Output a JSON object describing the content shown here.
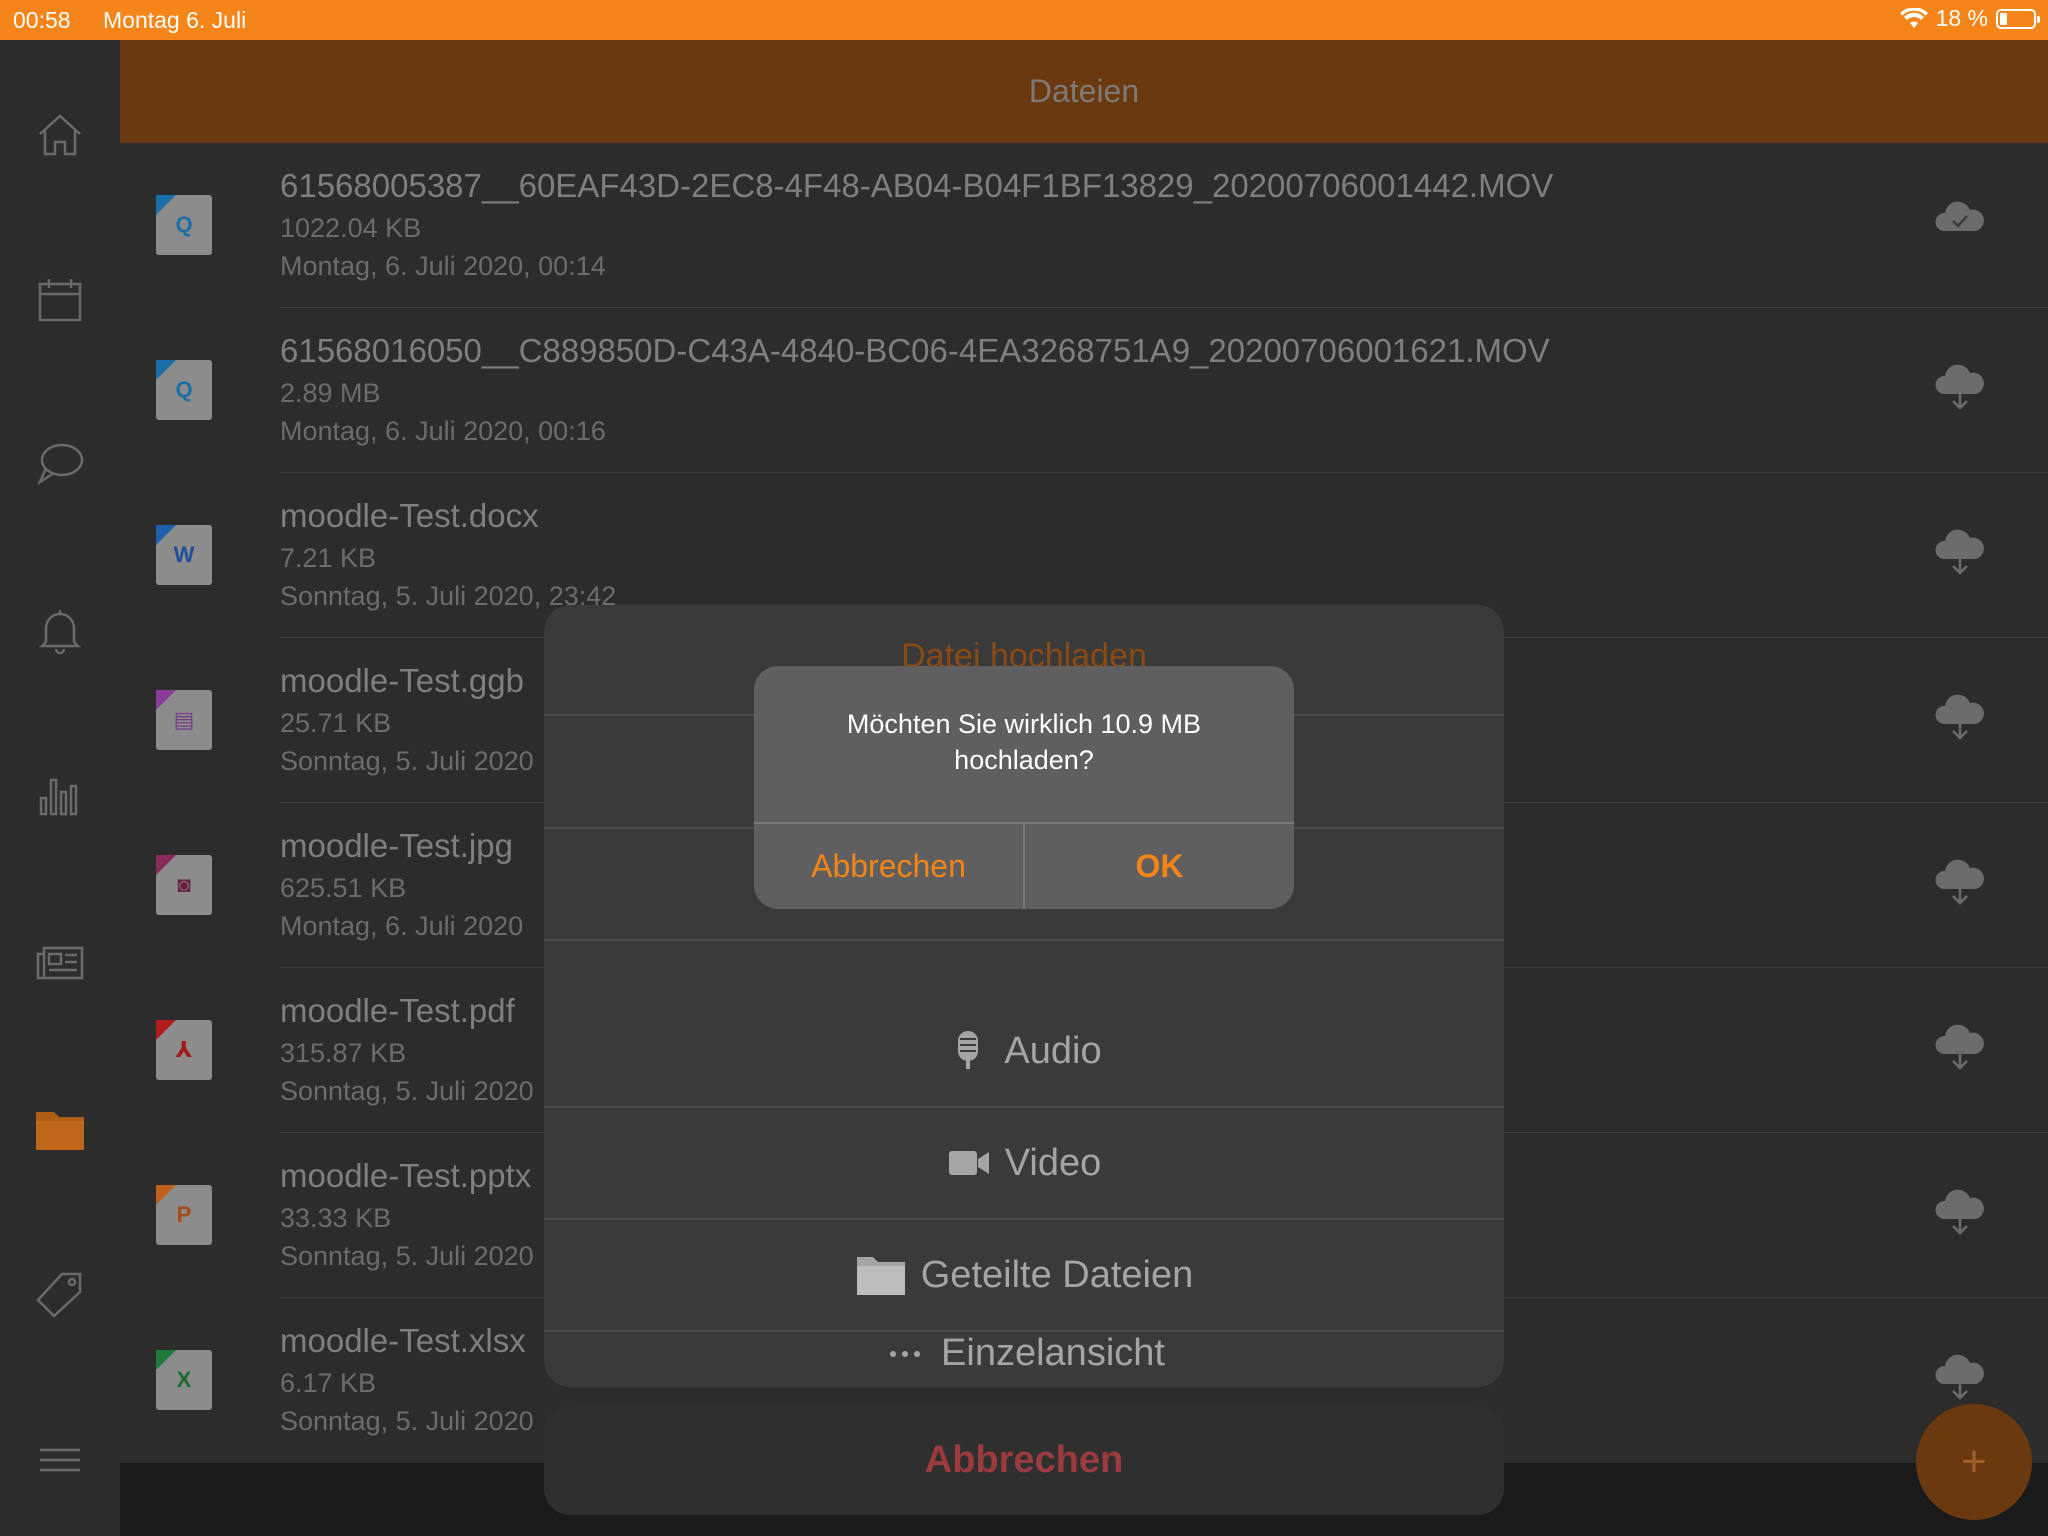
{
  "status_bar": {
    "time": "00:58",
    "date": "Montag 6. Juli",
    "battery": "18 %",
    "battery_level": 0.18
  },
  "sidebar": {
    "items": [
      {
        "icon": "home-icon"
      },
      {
        "icon": "calendar-icon"
      },
      {
        "icon": "chat-icon"
      },
      {
        "icon": "bell-icon"
      },
      {
        "icon": "bar-chart-icon"
      },
      {
        "icon": "news-icon"
      },
      {
        "icon": "folder-icon",
        "active": true
      },
      {
        "icon": "tag-icon"
      },
      {
        "icon": "menu-icon"
      }
    ]
  },
  "header": {
    "title": "Dateien"
  },
  "files": [
    {
      "name": "61568005387__60EAF43D-2EC8-4F48-AB04-B04F1BF13829_20200706001442.MOV",
      "size": "1022.04 KB",
      "date": "Montag, 6. Juli 2020, 00:14",
      "type": "mov",
      "status": "cloud-check-icon"
    },
    {
      "name": "61568016050__C889850D-C43A-4840-BC06-4EA3268751A9_20200706001621.MOV",
      "size": "2.89 MB",
      "date": "Montag, 6. Juli 2020, 00:16",
      "type": "mov",
      "status": "cloud-download-icon"
    },
    {
      "name": "moodle-Test.docx",
      "size": "7.21 KB",
      "date": "Sonntag, 5. Juli 2020, 23:42",
      "type": "docx",
      "status": "cloud-download-icon"
    },
    {
      "name": "moodle-Test.ggb",
      "size": "25.71 KB",
      "date": "Sonntag, 5. Juli 2020",
      "type": "ggb",
      "status": "cloud-download-icon"
    },
    {
      "name": "moodle-Test.jpg",
      "size": "625.51 KB",
      "date": "Montag, 6. Juli 2020",
      "type": "jpg",
      "status": "cloud-download-icon"
    },
    {
      "name": "moodle-Test.pdf",
      "size": "315.87 KB",
      "date": "Sonntag, 5. Juli 2020",
      "type": "pdf",
      "status": "cloud-download-icon"
    },
    {
      "name": "moodle-Test.pptx",
      "size": "33.33 KB",
      "date": "Sonntag, 5. Juli 2020",
      "type": "pptx",
      "status": "cloud-download-icon"
    },
    {
      "name": "moodle-Test.xlsx",
      "size": "6.17 KB",
      "date": "Sonntag, 5. Juli 2020",
      "type": "xlsx",
      "status": "cloud-download-icon"
    }
  ],
  "action_sheet": {
    "title": "Datei hochladen",
    "options": [
      {
        "label": "Audio",
        "icon": "microphone-icon"
      },
      {
        "label": "Video",
        "icon": "video-camera-icon"
      },
      {
        "label": "Geteilte Dateien",
        "icon": "folder-icon"
      },
      {
        "label": "Einzelansicht",
        "icon": "more-dots-icon"
      }
    ],
    "cancel": "Abbrechen"
  },
  "alert": {
    "message": "Möchten Sie wirklich 10.9 MB hochladen?",
    "cancel": "Abbrechen",
    "ok": "OK"
  },
  "fab": {
    "label": "+"
  },
  "colors": {
    "accent": "#f58518",
    "header": "#6b390f",
    "danger": "#9b3a3f"
  }
}
